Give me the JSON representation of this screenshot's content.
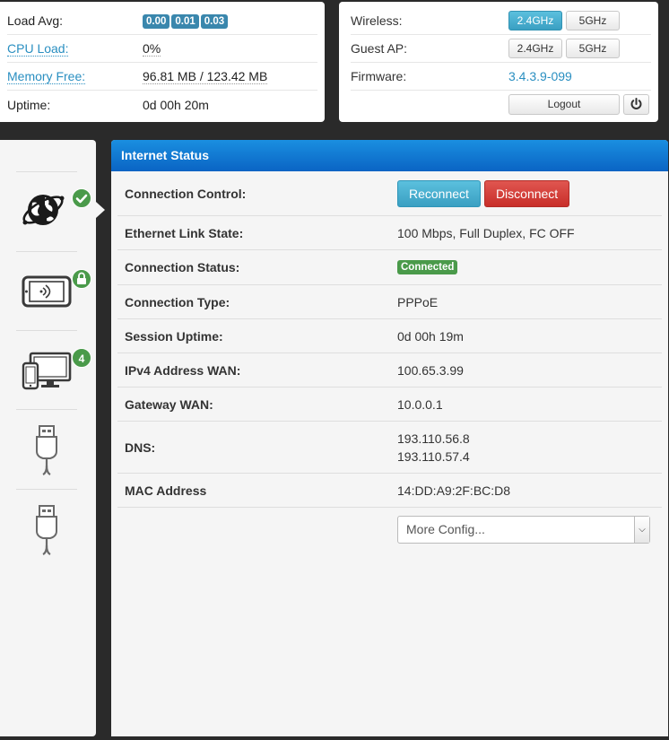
{
  "system": {
    "load_label": "Load Avg:",
    "load_values": [
      "0.00",
      "0.01",
      "0.03"
    ],
    "cpu_label": "CPU Load:",
    "cpu_value": "0%",
    "mem_label": "Memory Free:",
    "mem_value": "96.81 MB / 123.42 MB",
    "uptime_label": "Uptime:",
    "uptime_value": "0d 00h 20m"
  },
  "wireless": {
    "wireless_label": "Wireless:",
    "guest_label": "Guest AP:",
    "band_24": "2.4GHz",
    "band_5": "5GHz",
    "firmware_label": "Firmware:",
    "firmware_value": "3.4.3.9-099",
    "logout_label": "Logout"
  },
  "sidebar": {
    "items": [
      {
        "icon": "globe-icon",
        "badge_icon": "check-icon"
      },
      {
        "icon": "tablet-wifi-icon",
        "badge_icon": "lock-icon"
      },
      {
        "icon": "devices-icon",
        "badge": "4"
      },
      {
        "icon": "usb-icon"
      },
      {
        "icon": "usb-icon"
      }
    ]
  },
  "status": {
    "title": "Internet Status",
    "rows": {
      "control_label": "Connection Control:",
      "reconnect": "Reconnect",
      "disconnect": "Disconnect",
      "link_label": "Ethernet Link State:",
      "link_value": "100 Mbps, Full Duplex, FC OFF",
      "conn_status_label": "Connection Status:",
      "conn_status_value": "Connected",
      "conn_type_label": "Connection Type:",
      "conn_type_value": "PPPoE",
      "session_label": "Session Uptime:",
      "session_value": "0d 00h 19m",
      "ipv4_label": "IPv4 Address WAN:",
      "ipv4_value": "100.65.3.99",
      "gateway_label": "Gateway WAN:",
      "gateway_value": "10.0.0.1",
      "dns_label": "DNS:",
      "dns_values": [
        "193.110.56.8",
        "193.110.57.4"
      ],
      "mac_label": "MAC Address",
      "mac_value": "14:DD:A9:2F:BC:D8"
    },
    "more_config": "More Config..."
  },
  "colors": {
    "accent_blue": "#2a8fc1",
    "header_blue": "#0a64c4",
    "success_green": "#4a9a4a",
    "danger_red": "#c82e29",
    "info_cyan": "#5bc0de"
  }
}
